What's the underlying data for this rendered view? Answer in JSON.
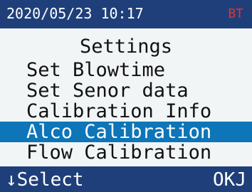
{
  "status_bar": {
    "datetime": "2020/05/23 10:17",
    "bt_label": "BT",
    "bt_color": "#e5312b"
  },
  "screen": {
    "title": "Settings"
  },
  "menu": {
    "items": [
      {
        "label": "Set Blowtime",
        "selected": false
      },
      {
        "label": "Set Senor data",
        "selected": false
      },
      {
        "label": "Calibration Info",
        "selected": false
      },
      {
        "label": "Alco Calibration",
        "selected": true
      },
      {
        "label": "Flow Calibration",
        "selected": false
      }
    ]
  },
  "footer": {
    "select_label": "↓Select",
    "ok_label": "OKJ"
  },
  "colors": {
    "bar_background": "#1f3f7a",
    "selection_highlight": "#0d75b8",
    "screen_background": "#f2f5f5"
  }
}
